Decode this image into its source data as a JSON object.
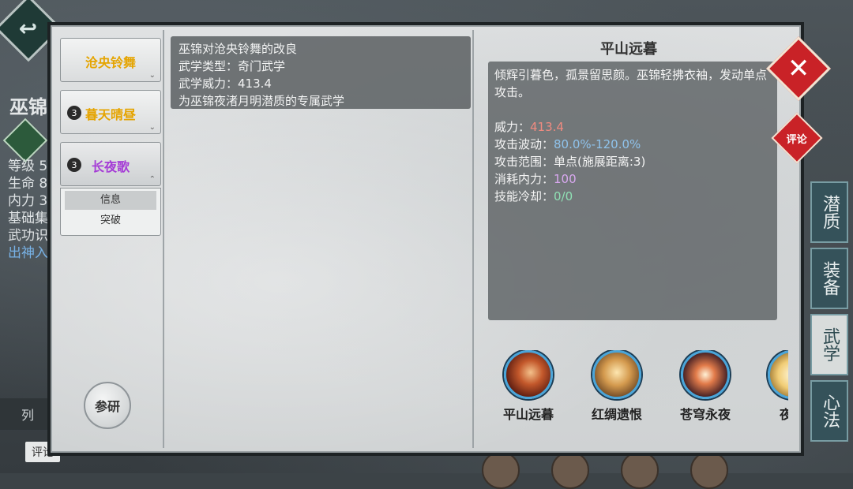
{
  "background": {
    "character_name": "巫锦",
    "stats": [
      "等级 5",
      "生命 8",
      "内力 3",
      "基础集",
      "武功识"
    ],
    "link": "出神入",
    "left_tab": "列",
    "comment_tab": "评论",
    "side_tabs": [
      "潜质",
      "装备",
      "武学",
      "心法"
    ]
  },
  "skills": [
    {
      "name": "沧央铃舞",
      "level": null,
      "color": "#e5a400"
    },
    {
      "name": "暮天晴昼",
      "level": "3",
      "color": "#e5a400"
    },
    {
      "name": "长夜歌",
      "level": "3",
      "color": "#a53cd6"
    }
  ],
  "submenu": [
    "信息",
    "突破"
  ],
  "research_label": "参研",
  "description": {
    "line1": "巫锦对沧央铃舞的改良",
    "type_label": "武学类型：",
    "type_value": "奇门武学",
    "power_label": "武学威力：",
    "power_value": "413.4",
    "line4": "为巫锦夜渚月明潜质的专属武学"
  },
  "detail": {
    "title": "平山远暮",
    "flavor": "倾辉引暮色，孤景留思颜。巫锦轻拂衣袖，发动单点攻击。",
    "stats": [
      {
        "label": "威力：",
        "value": "413.4",
        "cls": "val-red"
      },
      {
        "label": "攻击波动：",
        "value": "80.0%-120.0%",
        "cls": "val-blue"
      },
      {
        "label": "攻击范围：",
        "value": "单点(施展距离:3)",
        "cls": "val-none"
      },
      {
        "label": "消耗内力：",
        "value": "100",
        "cls": "val-purple"
      },
      {
        "label": "技能冷却：",
        "value": "0/0",
        "cls": "val-green"
      }
    ]
  },
  "skill_icons": [
    {
      "label": "平山远暮",
      "icon": "flame-slash-icon"
    },
    {
      "label": "红绸遗恨",
      "icon": "glowing-figure-icon"
    },
    {
      "label": "苍穹永夜",
      "icon": "cross-light-icon"
    },
    {
      "label": "夜尽",
      "icon": "sun-burst-icon"
    }
  ],
  "close_symbol": "✕",
  "comment_label": "评论"
}
